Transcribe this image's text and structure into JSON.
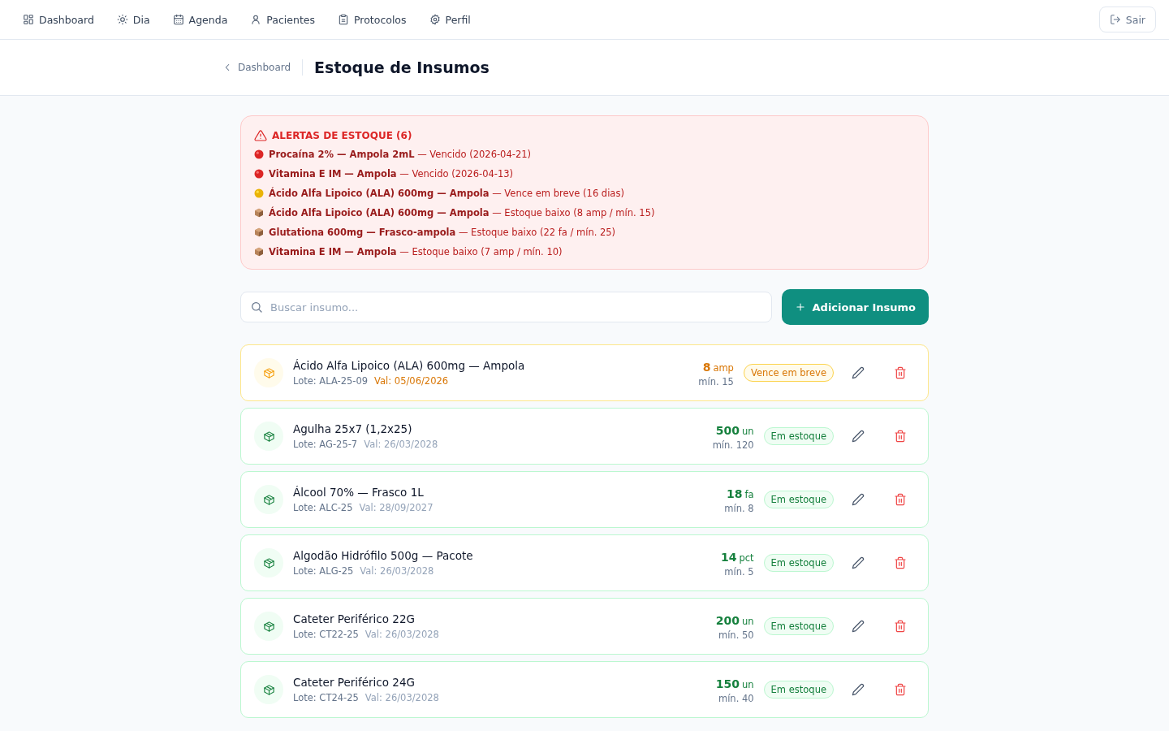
{
  "nav": {
    "items": [
      {
        "label": "Dashboard",
        "selected": false
      },
      {
        "label": "Dia",
        "selected": false
      },
      {
        "label": "Agenda",
        "selected": false
      },
      {
        "label": "Pacientes",
        "selected": false
      },
      {
        "label": "Protocolos",
        "selected": false
      },
      {
        "label": "Perfil",
        "selected": false
      }
    ],
    "logout": "Sair"
  },
  "header": {
    "back": "Dashboard",
    "title": "Estoque de Insumos"
  },
  "alerts": {
    "title": "ALERTAS DE ESTOQUE (6)",
    "items": [
      {
        "kind": "expired",
        "text": "**Procaína 2% — Ampola 2mL** — Vencido (2026-04-21)"
      },
      {
        "kind": "expired",
        "text": "**Vitamina E IM — Ampola** — Vencido (2026-04-13)"
      },
      {
        "kind": "expiring",
        "text": "**Ácido Alfa Lipoico (ALA) 600mg — Ampola** — Vence em breve (16 dias)"
      },
      {
        "kind": "low",
        "text": "**Ácido Alfa Lipoico (ALA) 600mg — Ampola** — Estoque baixo (8 amp / mín. 15)"
      },
      {
        "kind": "low",
        "text": "**Glutationa 600mg — Frasco-ampola** — Estoque baixo (22 fa / mín. 25)"
      },
      {
        "kind": "low",
        "text": "**Vitamina E IM — Ampola** — Estoque baixo (7 amp / mín. 10)"
      }
    ]
  },
  "search": {
    "placeholder": "Buscar insumo..."
  },
  "add_button": "Adicionar Insumo",
  "supplies": [
    {
      "name": "Ácido Alfa Lipoico (ALA) 600mg — Ampola",
      "lot": "Lote: ALA-25-09",
      "expiry": "Val: 05/06/2026",
      "qty": "8",
      "unit": "amp",
      "min": "mín. 15",
      "status": {
        "kind": "expiring",
        "label": "Vence em breve"
      }
    },
    {
      "name": "Agulha 25x7 (1,2x25)",
      "lot": "Lote: AG-25-7",
      "expiry": "Val: 26/03/2028",
      "qty": "500",
      "unit": "un",
      "min": "mín. 120",
      "status": {
        "kind": "ok",
        "label": "Em estoque"
      }
    },
    {
      "name": "Álcool 70% — Frasco 1L",
      "lot": "Lote: ALC-25",
      "expiry": "Val: 28/09/2027",
      "qty": "18",
      "unit": "fa",
      "min": "mín. 8",
      "status": {
        "kind": "ok",
        "label": "Em estoque"
      }
    },
    {
      "name": "Algodão Hidrófilo 500g — Pacote",
      "lot": "Lote: ALG-25",
      "expiry": "Val: 26/03/2028",
      "qty": "14",
      "unit": "pct",
      "min": "mín. 5",
      "status": {
        "kind": "ok",
        "label": "Em estoque"
      }
    },
    {
      "name": "Cateter Periférico 22G",
      "lot": "Lote: CT22-25",
      "expiry": "Val: 26/03/2028",
      "qty": "200",
      "unit": "un",
      "min": "mín. 50",
      "status": {
        "kind": "ok",
        "label": "Em estoque"
      }
    },
    {
      "name": "Cateter Periférico 24G",
      "lot": "Lote: CT24-25",
      "expiry": "Val: 26/03/2028",
      "qty": "150",
      "unit": "un",
      "min": "mín. 40",
      "status": {
        "kind": "ok",
        "label": "Em estoque"
      }
    }
  ]
}
